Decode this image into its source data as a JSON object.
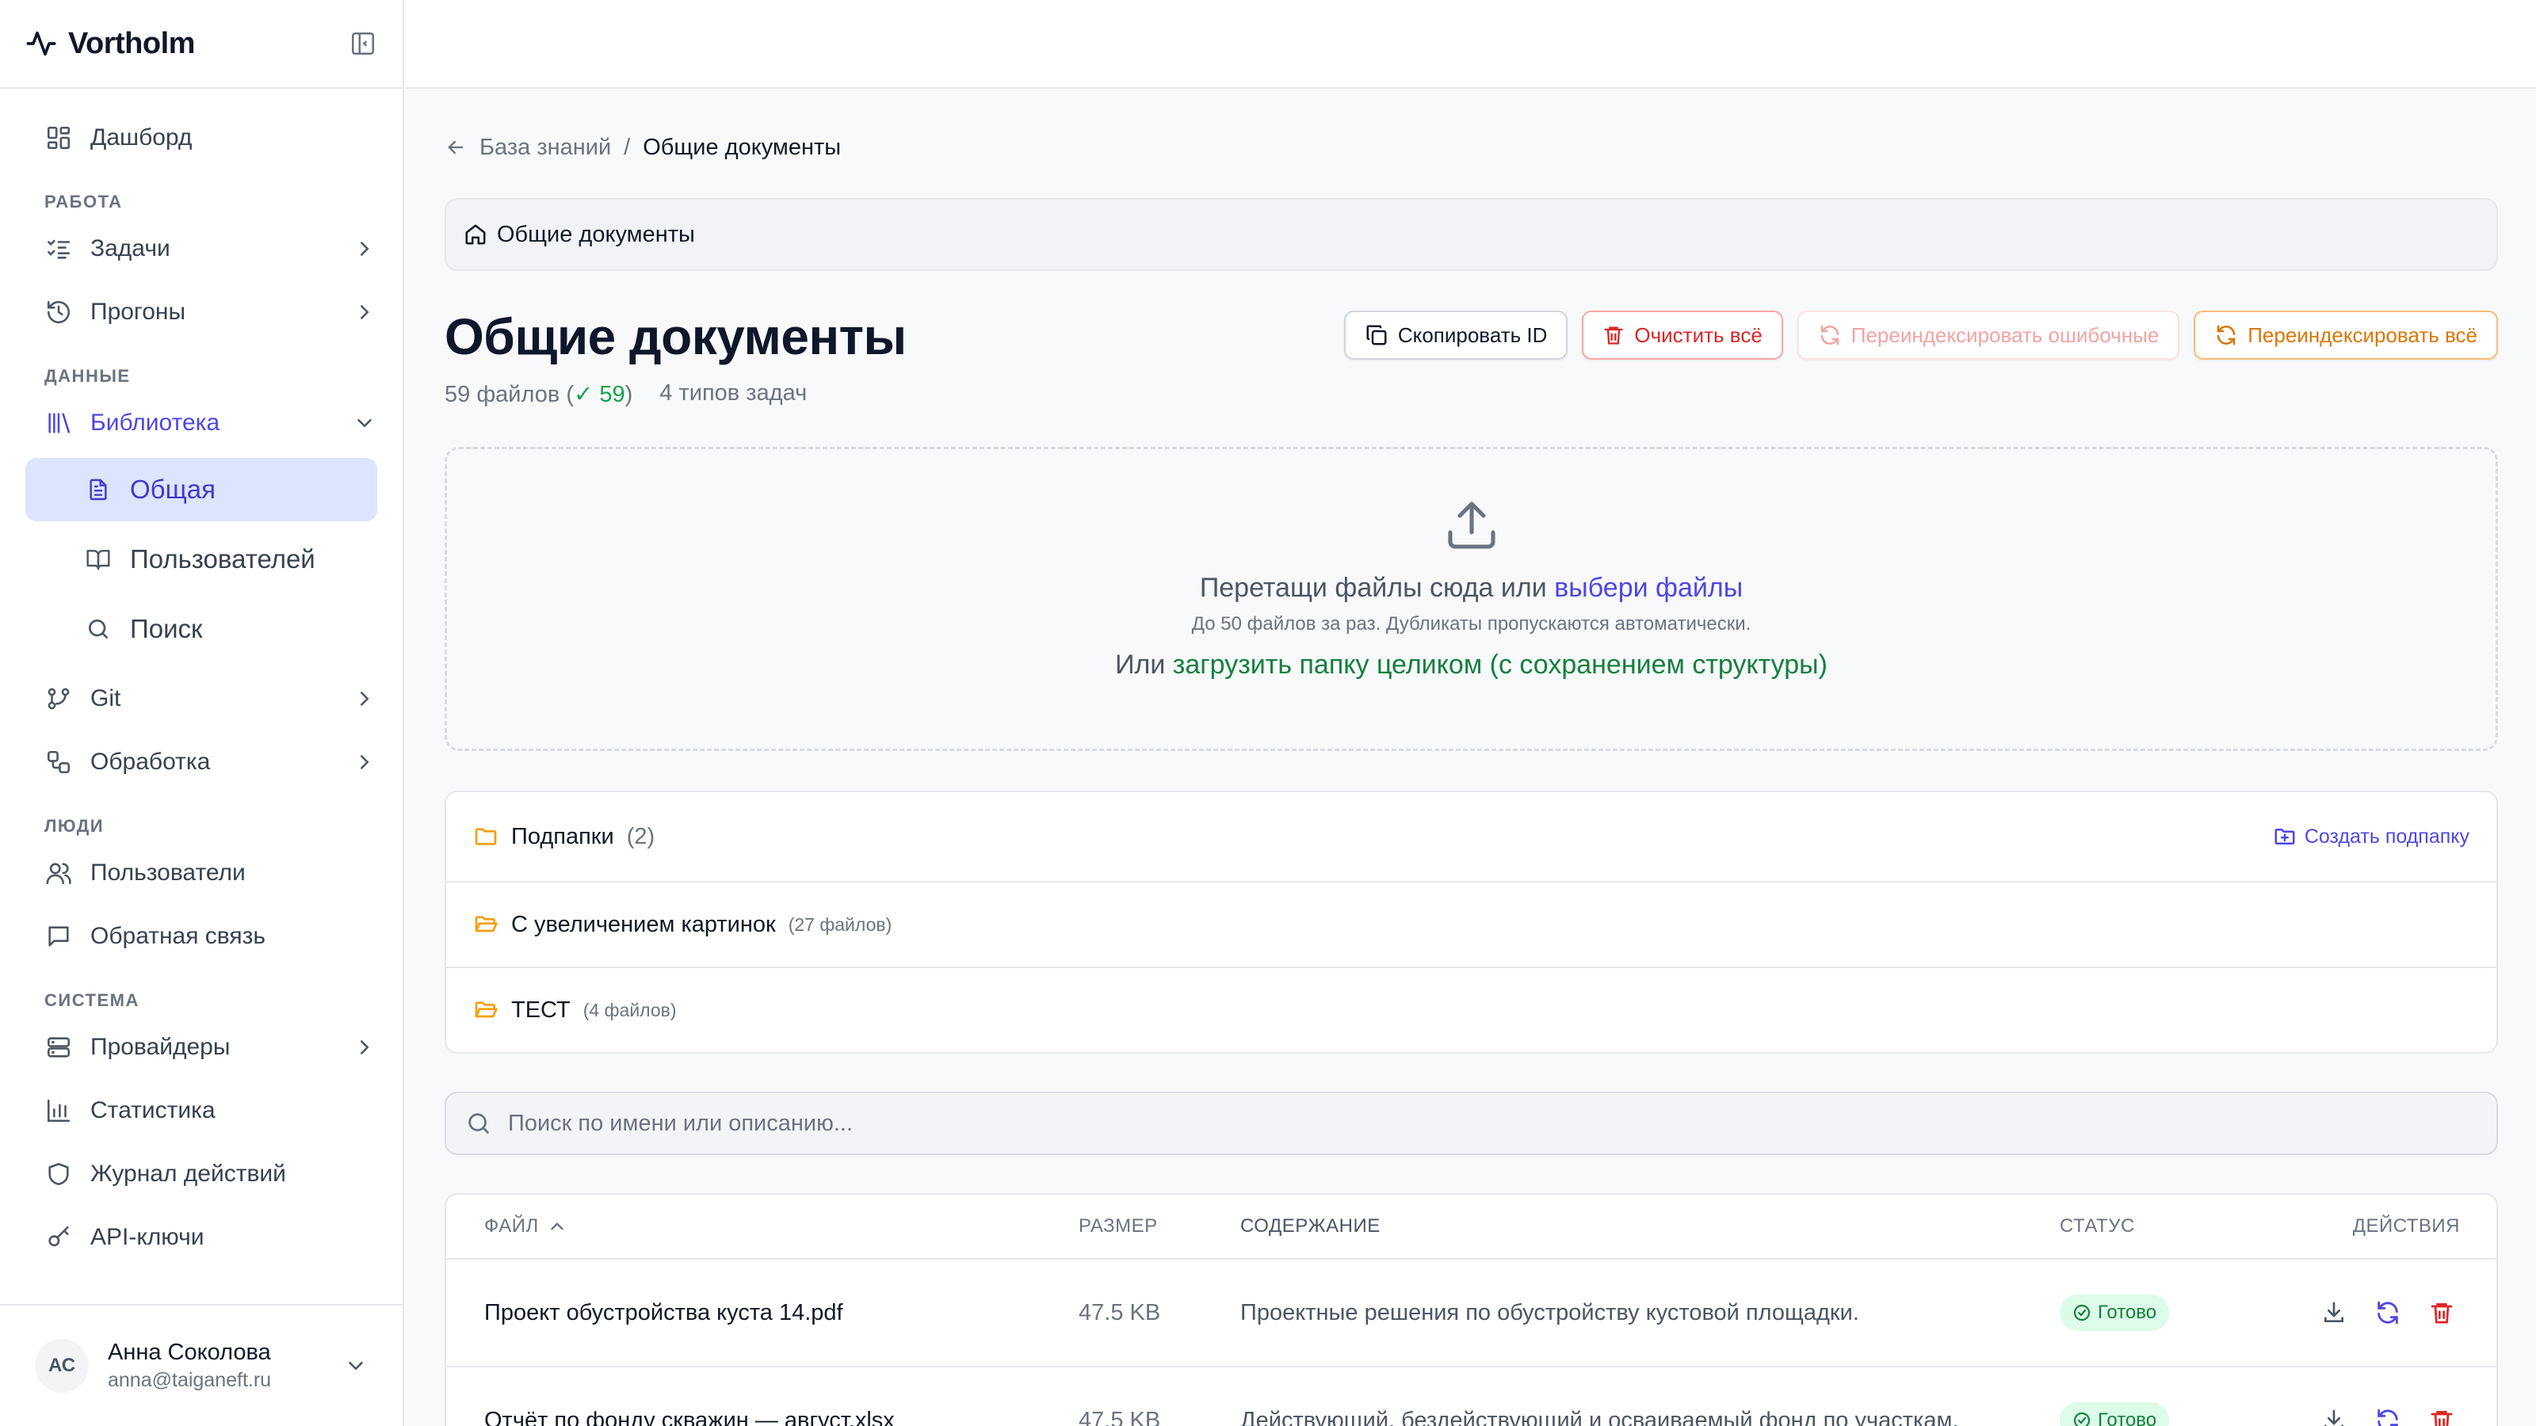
{
  "app": {
    "name": "Vortholm"
  },
  "sidebar": {
    "dashboard": "Дашборд",
    "sections": {
      "work": "РАБОТА",
      "data": "ДАННЫЕ",
      "people": "ЛЮДИ",
      "system": "СИСТЕМА"
    },
    "items": {
      "tasks": "Задачи",
      "runs": "Прогоны",
      "library": "Библиотека",
      "library_general": "Общая",
      "library_users": "Пользователей",
      "library_search": "Поиск",
      "git": "Git",
      "processing": "Обработка",
      "users": "Пользователи",
      "feedback": "Обратная связь",
      "providers": "Провайдеры",
      "statistics": "Статистика",
      "audit_log": "Журнал действий",
      "api_keys": "API-ключи"
    },
    "user": {
      "initials": "АС",
      "name": "Анна Соколова",
      "email": "anna@taiganeft.ru"
    }
  },
  "breadcrumb": {
    "parent": "База знаний",
    "separator": "/",
    "current": "Общие документы"
  },
  "pathbar": {
    "label": "Общие документы"
  },
  "page": {
    "title": "Общие документы",
    "files_count": "59 файлов (",
    "ready_count": "✓ 59",
    "files_close": ")",
    "task_types": "4 типов задач"
  },
  "actions": {
    "copy_id": "Скопировать ID",
    "clear_all": "Очистить всё",
    "reindex_failed": "Переиндексировать ошибочные",
    "reindex_all": "Переиндексировать всё"
  },
  "upload": {
    "prompt": "Перетащи файлы сюда или ",
    "choose_link": "выбери файлы",
    "hint": "До 50 файлов за раз. Дубликаты пропускаются автоматически.",
    "alt_prefix": "Или ",
    "folder_link": "загрузить папку целиком (с сохранением структуры)"
  },
  "folders": {
    "header": "Подпапки",
    "count": "(2)",
    "create": "Создать подпапку",
    "items": [
      {
        "name": "С увеличением картинок",
        "files": "(27 файлов)"
      },
      {
        "name": "ТЕСТ",
        "files": "(4 файлов)"
      }
    ]
  },
  "search": {
    "placeholder": "Поиск по имени или описанию..."
  },
  "table": {
    "columns": {
      "file": "ФАЙЛ",
      "size": "РАЗМЕР",
      "content": "СОДЕРЖАНИЕ",
      "status": "СТАТУС",
      "actions": "ДЕЙСТВИЯ"
    },
    "rows": [
      {
        "file": "Проект обустройства куста 14.pdf",
        "size": "47.5 KB",
        "content": "Проектные решения по обустройству кустовой площадки.",
        "status": "Готово"
      },
      {
        "file": "Отчёт по фонду скважин — август.xlsx",
        "size": "47.5 KB",
        "content": "Действующий, бездействующий и осваиваемый фонд по участкам.",
        "status": "Готово"
      }
    ]
  },
  "colors": {
    "accent": "#4f46e5",
    "success": "#16a34a",
    "danger": "#dc2626",
    "warning": "#d97706",
    "folder": "#f59e0b"
  }
}
